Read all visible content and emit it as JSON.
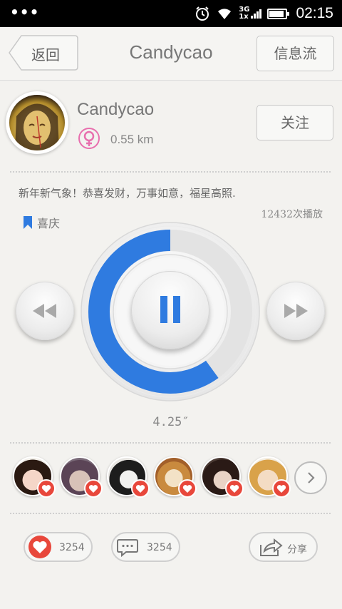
{
  "status_bar": {
    "time": "02:15",
    "network": "3G",
    "network2": "1x",
    "notification_icon": "dots-icon",
    "alarm_icon": "alarm-icon",
    "wifi_icon": "wifi-icon",
    "battery_level": 0.9
  },
  "header": {
    "back_label": "返回",
    "title": "Candycao",
    "feed_label": "信息流"
  },
  "profile": {
    "username": "Candycao",
    "gender_icon": "female-icon",
    "distance": "0.55 km",
    "follow_label": "关注"
  },
  "post": {
    "text": "新年新气象！恭喜发财，万事如意，福星高照.",
    "play_count": "12432次播放",
    "tag": "喜庆"
  },
  "player": {
    "progress": 0.6,
    "state": "playing",
    "duration": "4.25″",
    "accent": "#2f7be0"
  },
  "listeners": {
    "avatars": [
      {
        "icon": "heart-icon"
      },
      {
        "icon": "heart-icon"
      },
      {
        "icon": "heart-icon"
      },
      {
        "icon": "heart-icon"
      },
      {
        "icon": "heart-icon"
      },
      {
        "icon": "heart-icon"
      }
    ],
    "more_icon": "chevron-right-icon"
  },
  "actions": {
    "like_count": "3254",
    "comment_count": "3254",
    "share_label": "分享",
    "like_color": "#e8473b"
  }
}
